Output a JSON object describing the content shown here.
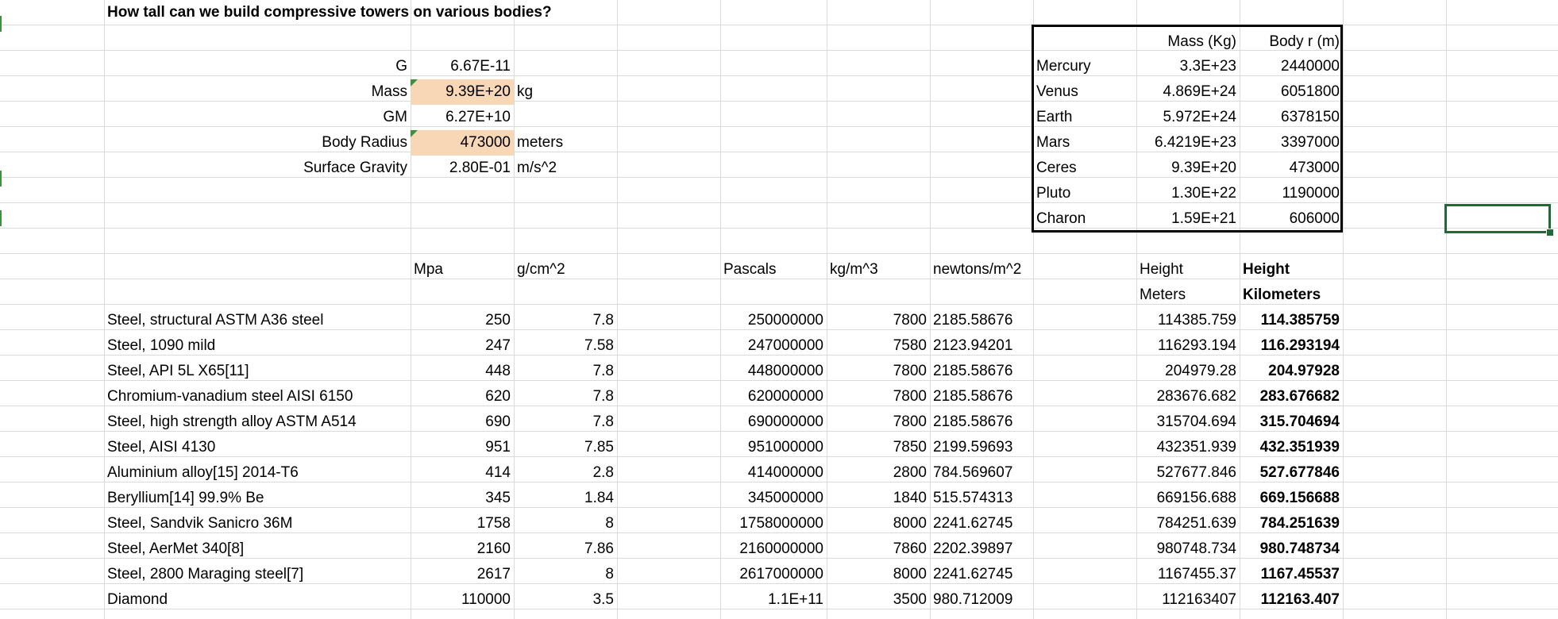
{
  "title": "How tall can we build compressive towers on various bodies?",
  "params": [
    {
      "label": "G",
      "value": "6.67E-11",
      "unit": "",
      "input": false
    },
    {
      "label": "Mass",
      "value": "9.39E+20",
      "unit": "kg",
      "input": true
    },
    {
      "label": "GM",
      "value": "6.27E+10",
      "unit": "",
      "input": false
    },
    {
      "label": "Body Radius",
      "value": "473000",
      "unit": "meters",
      "input": true
    },
    {
      "label": "Surface  Gravity",
      "value": "2.80E-01",
      "unit": "m/s^2",
      "input": false
    }
  ],
  "planets": {
    "header_mass": "Mass (Kg)",
    "header_radius": "Body r (m)",
    "rows": [
      {
        "name": "Mercury",
        "mass": "3.3E+23",
        "radius": "2440000"
      },
      {
        "name": "Venus",
        "mass": "4.869E+24",
        "radius": "6051800"
      },
      {
        "name": "Earth",
        "mass": "5.972E+24",
        "radius": "6378150"
      },
      {
        "name": "Mars",
        "mass": "6.4219E+23",
        "radius": "3397000"
      },
      {
        "name": "Ceres",
        "mass": "9.39E+20",
        "radius": "473000"
      },
      {
        "name": "Pluto",
        "mass": "1.30E+22",
        "radius": "1190000"
      },
      {
        "name": "Charon",
        "mass": "1.59E+21",
        "radius": "606000"
      }
    ]
  },
  "materials_header": {
    "mpa": "Mpa",
    "density": "g/cm^2",
    "pascals": "Pascals",
    "kgm3": "kg/m^3",
    "newtons": "newtons/m^2",
    "height_m_1": "Height",
    "height_m_2": "Meters",
    "height_km_1": "Height",
    "height_km_2": "Kilometers"
  },
  "materials": [
    {
      "name": "Steel, structural ASTM A36 steel",
      "mpa": "250",
      "density": "7.8",
      "pascals": "250000000",
      "kgm3": "7800",
      "newtons": "2185.58676",
      "height_m": "114385.759",
      "height_km": "114.385759"
    },
    {
      "name": "Steel, 1090 mild",
      "mpa": "247",
      "density": "7.58",
      "pascals": "247000000",
      "kgm3": "7580",
      "newtons": "2123.94201",
      "height_m": "116293.194",
      "height_km": "116.293194"
    },
    {
      "name": "Steel, API 5L X65[11]",
      "mpa": "448",
      "density": "7.8",
      "pascals": "448000000",
      "kgm3": "7800",
      "newtons": "2185.58676",
      "height_m": "204979.28",
      "height_km": "204.97928"
    },
    {
      "name": "Chromium-vanadium steel AISI 6150",
      "mpa": "620",
      "density": "7.8",
      "pascals": "620000000",
      "kgm3": "7800",
      "newtons": "2185.58676",
      "height_m": "283676.682",
      "height_km": "283.676682"
    },
    {
      "name": "Steel, high strength alloy ASTM A514",
      "mpa": "690",
      "density": "7.8",
      "pascals": "690000000",
      "kgm3": "7800",
      "newtons": "2185.58676",
      "height_m": "315704.694",
      "height_km": "315.704694"
    },
    {
      "name": "Steel, AISI 4130",
      "mpa": "951",
      "density": "7.85",
      "pascals": "951000000",
      "kgm3": "7850",
      "newtons": "2199.59693",
      "height_m": "432351.939",
      "height_km": "432.351939"
    },
    {
      "name": "Aluminium alloy[15] 2014-T6",
      "mpa": "414",
      "density": "2.8",
      "pascals": "414000000",
      "kgm3": "2800",
      "newtons": "784.569607",
      "height_m": "527677.846",
      "height_km": "527.677846"
    },
    {
      "name": "Beryllium[14] 99.9% Be",
      "mpa": "345",
      "density": "1.84",
      "pascals": "345000000",
      "kgm3": "1840",
      "newtons": "515.574313",
      "height_m": "669156.688",
      "height_km": "669.156688"
    },
    {
      "name": "Steel, Sandvik Sanicro 36M",
      "mpa": "1758",
      "density": "8",
      "pascals": "1758000000",
      "kgm3": "8000",
      "newtons": "2241.62745",
      "height_m": "784251.639",
      "height_km": "784.251639"
    },
    {
      "name": "Steel, AerMet 340[8]",
      "mpa": "2160",
      "density": "7.86",
      "pascals": "2160000000",
      "kgm3": "7860",
      "newtons": "2202.39897",
      "height_m": "980748.734",
      "height_km": "980.748734"
    },
    {
      "name": "Steel, 2800 Maraging steel[7]",
      "mpa": "2617",
      "density": "8",
      "pascals": "2617000000",
      "kgm3": "8000",
      "newtons": "2241.62745",
      "height_m": "1167455.37",
      "height_km": "1167.45537"
    },
    {
      "name": "Diamond",
      "mpa": "110000",
      "density": "3.5",
      "pascals": "1.1E+11",
      "kgm3": "3500",
      "newtons": "980.712009",
      "height_m": "112163407",
      "height_km": "112163.407"
    }
  ]
}
